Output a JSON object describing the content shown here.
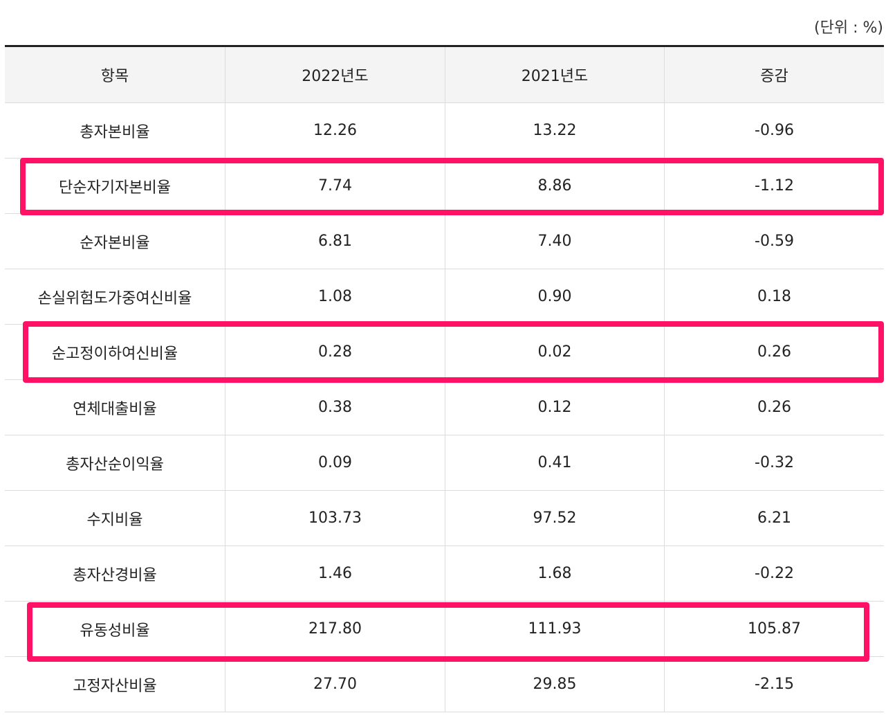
{
  "unit_label": "(단위 : %)",
  "highlight_color": "#ff1166",
  "columns": [
    "항목",
    "2022년도",
    "2021년도",
    "증감"
  ],
  "rows": [
    {
      "item": "총자본비율",
      "y2022": "12.26",
      "y2021": "13.22",
      "change": "-0.96",
      "highlighted": false
    },
    {
      "item": "단순자기자본비율",
      "y2022": "7.74",
      "y2021": "8.86",
      "change": "-1.12",
      "highlighted": true
    },
    {
      "item": "순자본비율",
      "y2022": "6.81",
      "y2021": "7.40",
      "change": "-0.59",
      "highlighted": false
    },
    {
      "item": "손실위험도가중여신비율",
      "y2022": "1.08",
      "y2021": "0.90",
      "change": "0.18",
      "highlighted": false
    },
    {
      "item": "순고정이하여신비율",
      "y2022": "0.28",
      "y2021": "0.02",
      "change": "0.26",
      "highlighted": true
    },
    {
      "item": "연체대출비율",
      "y2022": "0.38",
      "y2021": "0.12",
      "change": "0.26",
      "highlighted": false
    },
    {
      "item": "총자산순이익율",
      "y2022": "0.09",
      "y2021": "0.41",
      "change": "-0.32",
      "highlighted": false
    },
    {
      "item": "수지비율",
      "y2022": "103.73",
      "y2021": "97.52",
      "change": "6.21",
      "highlighted": false
    },
    {
      "item": "총자산경비율",
      "y2022": "1.46",
      "y2021": "1.68",
      "change": "-0.22",
      "highlighted": false
    },
    {
      "item": "유동성비율",
      "y2022": "217.80",
      "y2021": "111.93",
      "change": "105.87",
      "highlighted": true
    },
    {
      "item": "고정자산비율",
      "y2022": "27.70",
      "y2021": "29.85",
      "change": "-2.15",
      "highlighted": false
    }
  ]
}
